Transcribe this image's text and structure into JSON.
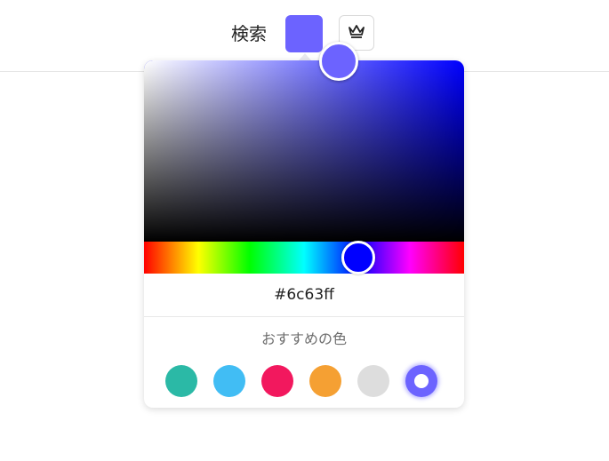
{
  "header": {
    "search_label": "検索",
    "current_color": "#6c63ff",
    "crown_icon": "crown-icon"
  },
  "picker": {
    "hue_color": "#0000ff",
    "hue_fraction": 0.67,
    "hex_value": "#6c63ff",
    "suggest_label": "おすすめの色",
    "swatches": [
      {
        "color": "#2bb9a6",
        "selected": false
      },
      {
        "color": "#41bdf4",
        "selected": false
      },
      {
        "color": "#f2185e",
        "selected": false
      },
      {
        "color": "#f5a033",
        "selected": false
      },
      {
        "color": "#dddddd",
        "selected": false
      },
      {
        "color": "#6c63ff",
        "selected": true
      }
    ]
  }
}
